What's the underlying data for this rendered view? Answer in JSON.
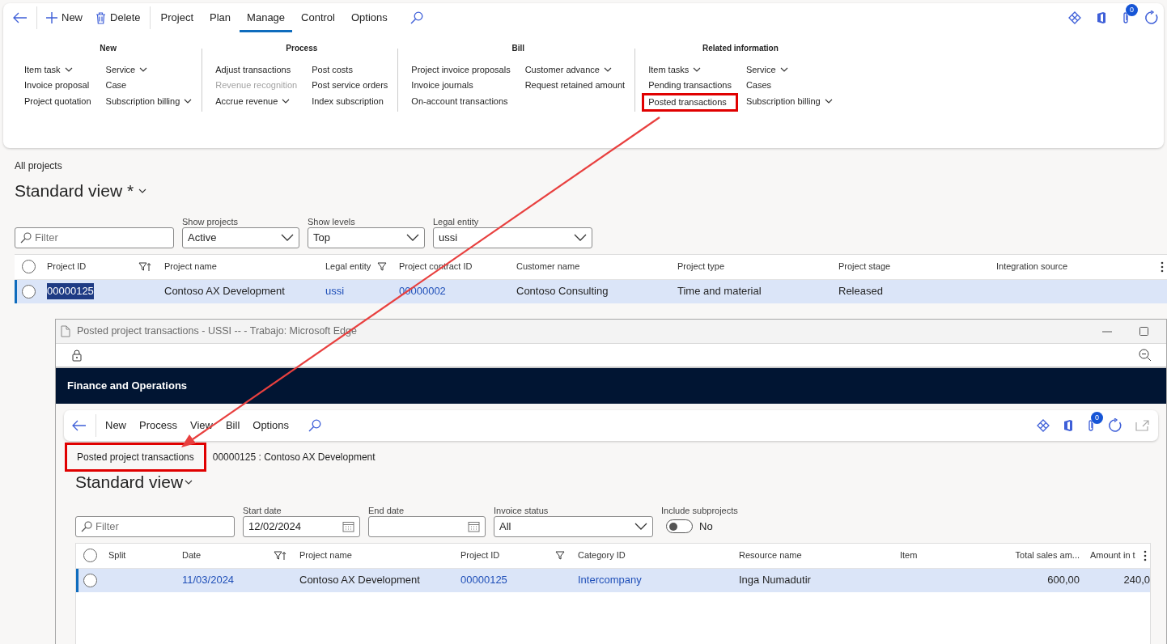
{
  "action_pane": {
    "buttons": [
      {
        "label": "New",
        "kind": "new"
      },
      {
        "label": "Delete",
        "kind": "delete"
      }
    ],
    "tabs": [
      {
        "label": "Project",
        "selected": false
      },
      {
        "label": "Plan",
        "selected": false
      },
      {
        "label": "Manage",
        "selected": true
      },
      {
        "label": "Control",
        "selected": false
      },
      {
        "label": "Options",
        "selected": false
      }
    ],
    "notification_count": "0",
    "groups": [
      {
        "title": "New",
        "columns": [
          [
            {
              "label": "Item task",
              "dropdown": true,
              "disabled": false,
              "highlighted": false
            },
            {
              "label": "Invoice proposal",
              "dropdown": false,
              "disabled": false,
              "highlighted": false
            },
            {
              "label": "Project quotation",
              "dropdown": false,
              "disabled": false,
              "highlighted": false
            }
          ],
          [
            {
              "label": "Service",
              "dropdown": true,
              "disabled": false,
              "highlighted": false
            },
            {
              "label": "Case",
              "dropdown": false,
              "disabled": false,
              "highlighted": false
            },
            {
              "label": "Subscription billing",
              "dropdown": true,
              "disabled": false,
              "highlighted": false
            }
          ]
        ]
      },
      {
        "title": "Process",
        "columns": [
          [
            {
              "label": "Adjust transactions",
              "dropdown": false,
              "disabled": false,
              "highlighted": false
            },
            {
              "label": "Revenue recognition",
              "dropdown": false,
              "disabled": true,
              "highlighted": false
            },
            {
              "label": "Accrue revenue",
              "dropdown": true,
              "disabled": false,
              "highlighted": false
            }
          ],
          [
            {
              "label": "Post costs",
              "dropdown": false,
              "disabled": false,
              "highlighted": false
            },
            {
              "label": "Post service orders",
              "dropdown": false,
              "disabled": false,
              "highlighted": false
            },
            {
              "label": "Index subscription",
              "dropdown": false,
              "disabled": false,
              "highlighted": false
            }
          ]
        ]
      },
      {
        "title": "Bill",
        "columns": [
          [
            {
              "label": "Project invoice proposals",
              "dropdown": false,
              "disabled": false,
              "highlighted": false
            },
            {
              "label": "Invoice journals",
              "dropdown": false,
              "disabled": false,
              "highlighted": false
            },
            {
              "label": "On-account transactions",
              "dropdown": false,
              "disabled": false,
              "highlighted": false
            }
          ],
          [
            {
              "label": "Customer advance",
              "dropdown": true,
              "disabled": false,
              "highlighted": false
            },
            {
              "label": "Request retained amount",
              "dropdown": false,
              "disabled": false,
              "highlighted": false
            }
          ]
        ]
      },
      {
        "title": "Related information",
        "columns": [
          [
            {
              "label": "Item tasks",
              "dropdown": true,
              "disabled": false,
              "highlighted": false
            },
            {
              "label": "Pending transactions",
              "dropdown": false,
              "disabled": false,
              "highlighted": false
            },
            {
              "label": "Posted transactions",
              "dropdown": false,
              "disabled": false,
              "highlighted": true
            }
          ],
          [
            {
              "label": "Service",
              "dropdown": true,
              "disabled": false,
              "highlighted": false
            },
            {
              "label": "Cases",
              "dropdown": false,
              "disabled": false,
              "highlighted": false
            },
            {
              "label": "Subscription billing",
              "dropdown": true,
              "disabled": false,
              "highlighted": false
            }
          ]
        ]
      }
    ]
  },
  "page": {
    "breadcrumb": "All projects",
    "view_title": "Standard view *",
    "filter": {
      "placeholder": "Filter"
    },
    "fields": [
      {
        "kind": "select",
        "label": "Show projects",
        "value": "Active"
      },
      {
        "kind": "select",
        "label": "Show levels",
        "value": "Top"
      },
      {
        "kind": "select",
        "label": "Legal entity",
        "value": "ussi"
      }
    ],
    "grid": {
      "all_selected": false,
      "columns": [
        {
          "label": "Project ID",
          "filtered": true,
          "sorted": true
        },
        {
          "label": "Project name",
          "filtered": false,
          "sorted": false
        },
        {
          "label": "Legal entity",
          "filtered": true,
          "sorted": false
        },
        {
          "label": "Project contract ID",
          "filtered": false,
          "sorted": false
        },
        {
          "label": "Customer name",
          "filtered": false,
          "sorted": false
        },
        {
          "label": "Project type",
          "filtered": false,
          "sorted": false
        },
        {
          "label": "Project stage",
          "filtered": false,
          "sorted": false
        },
        {
          "label": "Integration source",
          "filtered": false,
          "sorted": false
        }
      ],
      "rows": [
        {
          "selected": true,
          "cells": [
            {
              "text": "00000125",
              "kind": "selected-text"
            },
            {
              "text": "Contoso AX Development",
              "kind": "text"
            },
            {
              "text": "ussi",
              "kind": "link"
            },
            {
              "text": "00000002",
              "kind": "link"
            },
            {
              "text": "Contoso Consulting",
              "kind": "text"
            },
            {
              "text": "Time and material",
              "kind": "text"
            },
            {
              "text": "Released",
              "kind": "text"
            },
            null
          ]
        }
      ]
    }
  },
  "popup": {
    "title": "Posted project transactions - USSI -- - Trabajo: Microsoft Edge",
    "app_name": "Finance and Operations",
    "menu": [
      "New",
      "Process",
      "View",
      "Bill",
      "Options"
    ],
    "notification_count": "0",
    "breadcrumb": {
      "text": "Posted project transactions",
      "highlighted": true
    },
    "record": "00000125 : Contoso AX Development",
    "view_title": "Standard view",
    "filter": {
      "placeholder": "Filter"
    },
    "fields": [
      {
        "kind": "date",
        "label": "Start date",
        "value": "12/02/2024"
      },
      {
        "kind": "date",
        "label": "End date"
      },
      {
        "kind": "select",
        "label": "Invoice status",
        "value": "All"
      },
      {
        "kind": "toggle",
        "label": "Include subprojects",
        "on": false,
        "value": "No"
      }
    ],
    "grid": {
      "all_selected": false,
      "columns": [
        {
          "label": "Split",
          "kind": "text",
          "filtered": false,
          "sorted": false
        },
        {
          "label": "Date",
          "kind": "text",
          "filtered": true,
          "sorted": true
        },
        {
          "label": "Project name",
          "kind": "text",
          "filtered": false,
          "sorted": false
        },
        {
          "label": "Project ID",
          "kind": "text",
          "filtered": true,
          "sorted": false
        },
        {
          "label": "Category ID",
          "kind": "text",
          "filtered": false,
          "sorted": false
        },
        {
          "label": "Resource name",
          "kind": "text",
          "filtered": false,
          "sorted": false
        },
        {
          "label": "Item",
          "kind": "text",
          "filtered": false,
          "sorted": false
        },
        {
          "label": "Total sales am...",
          "kind": "number",
          "filtered": false,
          "sorted": false
        },
        {
          "label": "Amount in t",
          "kind": "number",
          "filtered": false,
          "sorted": false
        }
      ],
      "rows": [
        {
          "selected": true,
          "cells": [
            null,
            {
              "text": "11/03/2024",
              "kind": "link"
            },
            {
              "text": "Contoso AX Development",
              "kind": "text"
            },
            {
              "text": "00000125",
              "kind": "link"
            },
            {
              "text": "Intercompany",
              "kind": "link"
            },
            {
              "text": "Inga Numadutir",
              "kind": "text"
            },
            null,
            {
              "text": "600,00",
              "kind": "number"
            },
            {
              "text": "240,0",
              "kind": "number"
            }
          ]
        }
      ]
    }
  }
}
